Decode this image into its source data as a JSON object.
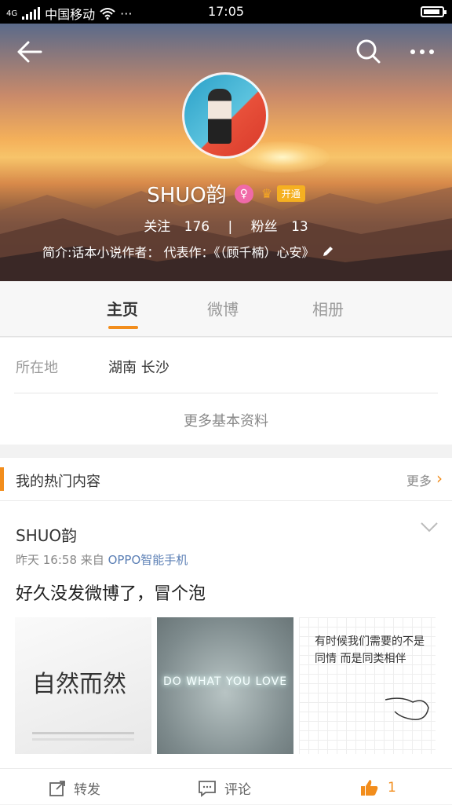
{
  "status_bar": {
    "carrier": "中国移动",
    "network": "4G",
    "time": "17:05",
    "battery_level": 0.85
  },
  "profile": {
    "name": "SHUO韵",
    "gender_icon": "female-icon",
    "vip_label": "开通",
    "follow_label": "关注",
    "follow_count": "176",
    "fans_label": "粉丝",
    "fans_count": "13",
    "bio": "简介:话本小说作者： 代表作：《（顾千楠）心安》"
  },
  "tabs": [
    {
      "label": "主页",
      "active": true
    },
    {
      "label": "微博",
      "active": false
    },
    {
      "label": "相册",
      "active": false
    }
  ],
  "info": {
    "location_label": "所在地",
    "location_value": "湖南 长沙",
    "more_info": "更多基本资料"
  },
  "hot": {
    "title": "我的热门内容",
    "more": "更多"
  },
  "post": {
    "author": "SHUO韵",
    "time": "昨天 16:58",
    "from_label": "来自",
    "source": "OPPO智能手机",
    "text": "好久没发微博了，冒个泡",
    "images": [
      {
        "caption": "自然而然"
      },
      {
        "caption": "DO WHAT YOU LOVE"
      },
      {
        "caption": "有时候我们需要的不是同情 而是同类相伴"
      }
    ],
    "actions": {
      "repost": "转发",
      "comment": "评论",
      "like_count": "1"
    }
  },
  "colors": {
    "accent": "#f28d1c",
    "link": "#5b7fb5"
  }
}
